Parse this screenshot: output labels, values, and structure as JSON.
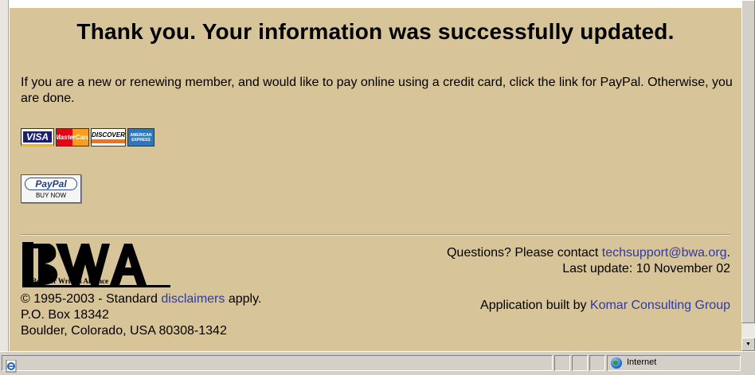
{
  "headline": "Thank you. Your information was successfully updated.",
  "intro": "If you are a new or renewing member, and would like to pay online using a credit card, click the link for PayPal. Otherwise, you are done.",
  "cards": {
    "visa": "VISA",
    "mastercard": "MasterCard",
    "discover": "DISCOVER",
    "amex": "AMERICAN EXPRESS"
  },
  "paypal": {
    "logo": "PayPal",
    "buy_now": "BUY NOW"
  },
  "logo": {
    "letters": "BWA",
    "name": "Boulder Writers Alliance"
  },
  "footer": {
    "copyright_prefix": "© 1995-2003 - Standard ",
    "disclaimers_link": "disclaimers",
    "copyright_suffix": " apply.",
    "po_box": "P.O. Box 18342",
    "city": "Boulder, Colorado, USA 80308-1342",
    "questions_prefix": "Questions? Please contact ",
    "support_email": "techsupport@bwa.org",
    "questions_suffix": ".",
    "last_update": "Last update: 10 November 02",
    "built_prefix": "Application built by ",
    "builder_link": "Komar Consulting Group"
  },
  "statusbar": {
    "zone": "Internet",
    "zone_icon": "globe-icon",
    "page_icon": "ie-page-icon"
  },
  "colors": {
    "page_background": "#d8c499",
    "link": "#2c3aa8"
  }
}
